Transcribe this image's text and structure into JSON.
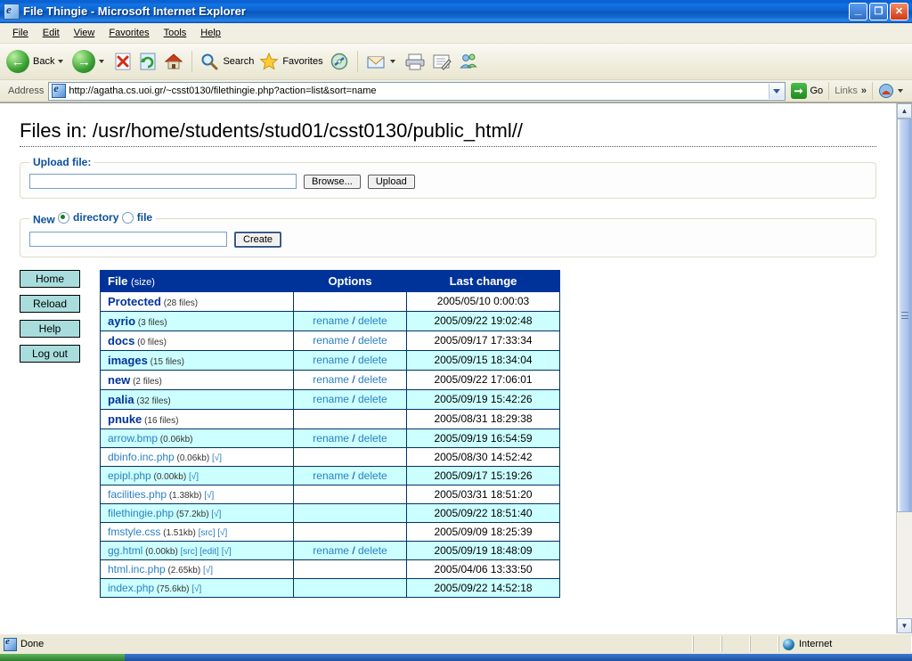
{
  "window": {
    "title": "File Thingie - Microsoft Internet Explorer",
    "icon": "ie-page-icon",
    "minimize_label": "_",
    "restore_label": "❐",
    "close_label": "✕"
  },
  "menubar": {
    "items": [
      {
        "label": "File",
        "accel": "F"
      },
      {
        "label": "Edit",
        "accel": "E"
      },
      {
        "label": "View",
        "accel": "V"
      },
      {
        "label": "Favorites",
        "accel": "a"
      },
      {
        "label": "Tools",
        "accel": "T"
      },
      {
        "label": "Help",
        "accel": "H"
      }
    ]
  },
  "toolbar": {
    "back_label": "Back",
    "forward_label": "",
    "stop_label": "",
    "refresh_label": "",
    "home_label": "",
    "search_label": "Search",
    "favorites_label": "Favorites",
    "history_label": "",
    "mail_label": "",
    "print_label": "",
    "edit_label": "",
    "messenger_label": ""
  },
  "address": {
    "label": "Address",
    "url": "http://agatha.cs.uoi.gr/~csst0130/filethingie.php?action=list&sort=name",
    "go_label": "Go",
    "links_label": "Links",
    "chevron": "»"
  },
  "page": {
    "title": "Files in: /usr/home/students/stud01/csst0130/public_html//",
    "upload": {
      "legend": "Upload file:",
      "input_value": "",
      "browse_label": "Browse...",
      "upload_label": "Upload"
    },
    "create": {
      "legend_new": "New",
      "option_directory": "directory",
      "option_file": "file",
      "selected": "directory",
      "input_value": "",
      "create_label": "Create"
    },
    "sidebar": {
      "items": [
        {
          "label": "Home"
        },
        {
          "label": "Reload"
        },
        {
          "label": "Help"
        },
        {
          "label": "Log out"
        }
      ]
    },
    "table": {
      "headers": {
        "file": "File",
        "file_size": "(size)",
        "options": "Options",
        "last_change": "Last change"
      },
      "option_rename": "rename",
      "option_sep": "/",
      "option_delete": "delete",
      "rows": [
        {
          "name": "Protected",
          "meta": "(28 files)",
          "tags": [],
          "type": "dir",
          "options": false,
          "date": "2005/05/10 0:00:03",
          "alt": false
        },
        {
          "name": "ayrio",
          "meta": "(3 files)",
          "tags": [],
          "type": "dir",
          "options": true,
          "date": "2005/09/22 19:02:48",
          "alt": true
        },
        {
          "name": "docs",
          "meta": "(0 files)",
          "tags": [],
          "type": "dir",
          "options": true,
          "date": "2005/09/17 17:33:34",
          "alt": false
        },
        {
          "name": "images",
          "meta": "(15 files)",
          "tags": [],
          "type": "dir",
          "options": true,
          "date": "2005/09/15 18:34:04",
          "alt": true
        },
        {
          "name": "new",
          "meta": "(2 files)",
          "tags": [],
          "type": "dir",
          "options": true,
          "date": "2005/09/22 17:06:01",
          "alt": false
        },
        {
          "name": "palia",
          "meta": "(32 files)",
          "tags": [],
          "type": "dir",
          "options": true,
          "date": "2005/09/19 15:42:26",
          "alt": true
        },
        {
          "name": "pnuke",
          "meta": "(16 files)",
          "tags": [],
          "type": "dir",
          "options": false,
          "date": "2005/08/31 18:29:38",
          "alt": false
        },
        {
          "name": "arrow.bmp",
          "meta": "(0.06kb)",
          "tags": [],
          "type": "file",
          "options": true,
          "date": "2005/09/19 16:54:59",
          "alt": true
        },
        {
          "name": "dbinfo.inc.php",
          "meta": "(0.06kb)",
          "tags": [
            "√"
          ],
          "type": "file",
          "options": false,
          "date": "2005/08/30 14:52:42",
          "alt": false
        },
        {
          "name": "epipl.php",
          "meta": "(0.00kb)",
          "tags": [
            "√"
          ],
          "type": "file",
          "options": true,
          "date": "2005/09/17 15:19:26",
          "alt": true
        },
        {
          "name": "facilities.php",
          "meta": "(1.38kb)",
          "tags": [
            "√"
          ],
          "type": "file",
          "options": false,
          "date": "2005/03/31 18:51:20",
          "alt": false
        },
        {
          "name": "filethingie.php",
          "meta": "(57.2kb)",
          "tags": [
            "√"
          ],
          "type": "file",
          "options": false,
          "date": "2005/09/22 18:51:40",
          "alt": true
        },
        {
          "name": "fmstyle.css",
          "meta": "(1.51kb)",
          "tags": [
            "src",
            "√"
          ],
          "type": "file",
          "options": false,
          "date": "2005/09/09 18:25:39",
          "alt": false
        },
        {
          "name": "gg.html",
          "meta": "(0.00kb)",
          "tags": [
            "src",
            "edit",
            "√"
          ],
          "type": "file",
          "options": true,
          "date": "2005/09/19 18:48:09",
          "alt": true
        },
        {
          "name": "html.inc.php",
          "meta": "(2.65kb)",
          "tags": [
            "√"
          ],
          "type": "file",
          "options": false,
          "date": "2005/04/06 13:33:50",
          "alt": false
        },
        {
          "name": "index.php",
          "meta": "(75.6kb)",
          "tags": [
            "√"
          ],
          "type": "file",
          "options": false,
          "date": "2005/09/22 14:52:18",
          "alt": true
        }
      ]
    }
  },
  "statusbar": {
    "text": "Done",
    "zone": "Internet"
  },
  "colors": {
    "table_header": "#003399",
    "row_alt": "#ccffff",
    "dir_name": "#003399",
    "file_link": "#2a7fc0",
    "legend": "#0b4f9e",
    "sidebar_button": "#a9dddd",
    "titlebar": "#0d63cf"
  }
}
